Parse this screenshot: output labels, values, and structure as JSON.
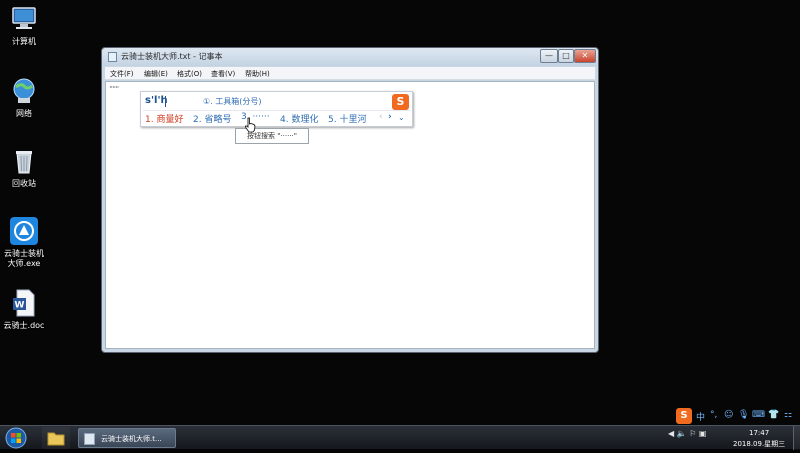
{
  "desktop": {
    "icons": [
      {
        "label": "计算机",
        "icon": "computer-icon"
      },
      {
        "label": "网络",
        "icon": "network-icon"
      },
      {
        "label": "回收站",
        "icon": "recycle-bin-icon"
      },
      {
        "label_line1": "云骑士装机",
        "label_line2": "大师.exe",
        "icon": "yunqishi-installer-icon"
      },
      {
        "label": "云骑士.doc",
        "icon": "word-document-icon"
      }
    ]
  },
  "window": {
    "title": "云骑士装机大师.txt - 记事本",
    "minimize": "—",
    "maximize": "□",
    "close": "✕",
    "menu": [
      "文件(F)",
      "编辑(E)",
      "格式(O)",
      "查看(V)",
      "帮助(H)"
    ],
    "content": "······"
  },
  "ime": {
    "composition": "s'l'h",
    "hint": "①. 工具箱(分号)",
    "logo": "S",
    "candidates": [
      "1. 商量好",
      "2. 省略号",
      "3. ······",
      "4. 数理化",
      "5. 十里河"
    ],
    "prev": "‹",
    "next": "›",
    "more": "⌄",
    "tooltip": "按钮搜索 \"······\""
  },
  "taskbar": {
    "task_label": "云骑士装机大师.t...",
    "tray_icons": "◀ 🔈 ⚐ ▣",
    "time": "17:47",
    "date": "2018.09.星期三"
  },
  "imebar": {
    "logo": "S",
    "items": [
      "中",
      "°,",
      "☺",
      "🎙",
      "⌨",
      "👕",
      "⚏"
    ]
  },
  "colors": {
    "ime_accent": "#f06a1f",
    "candidate_first": "#d23a1e",
    "candidate": "#2f6db3",
    "desktop_bg": "#060606"
  }
}
